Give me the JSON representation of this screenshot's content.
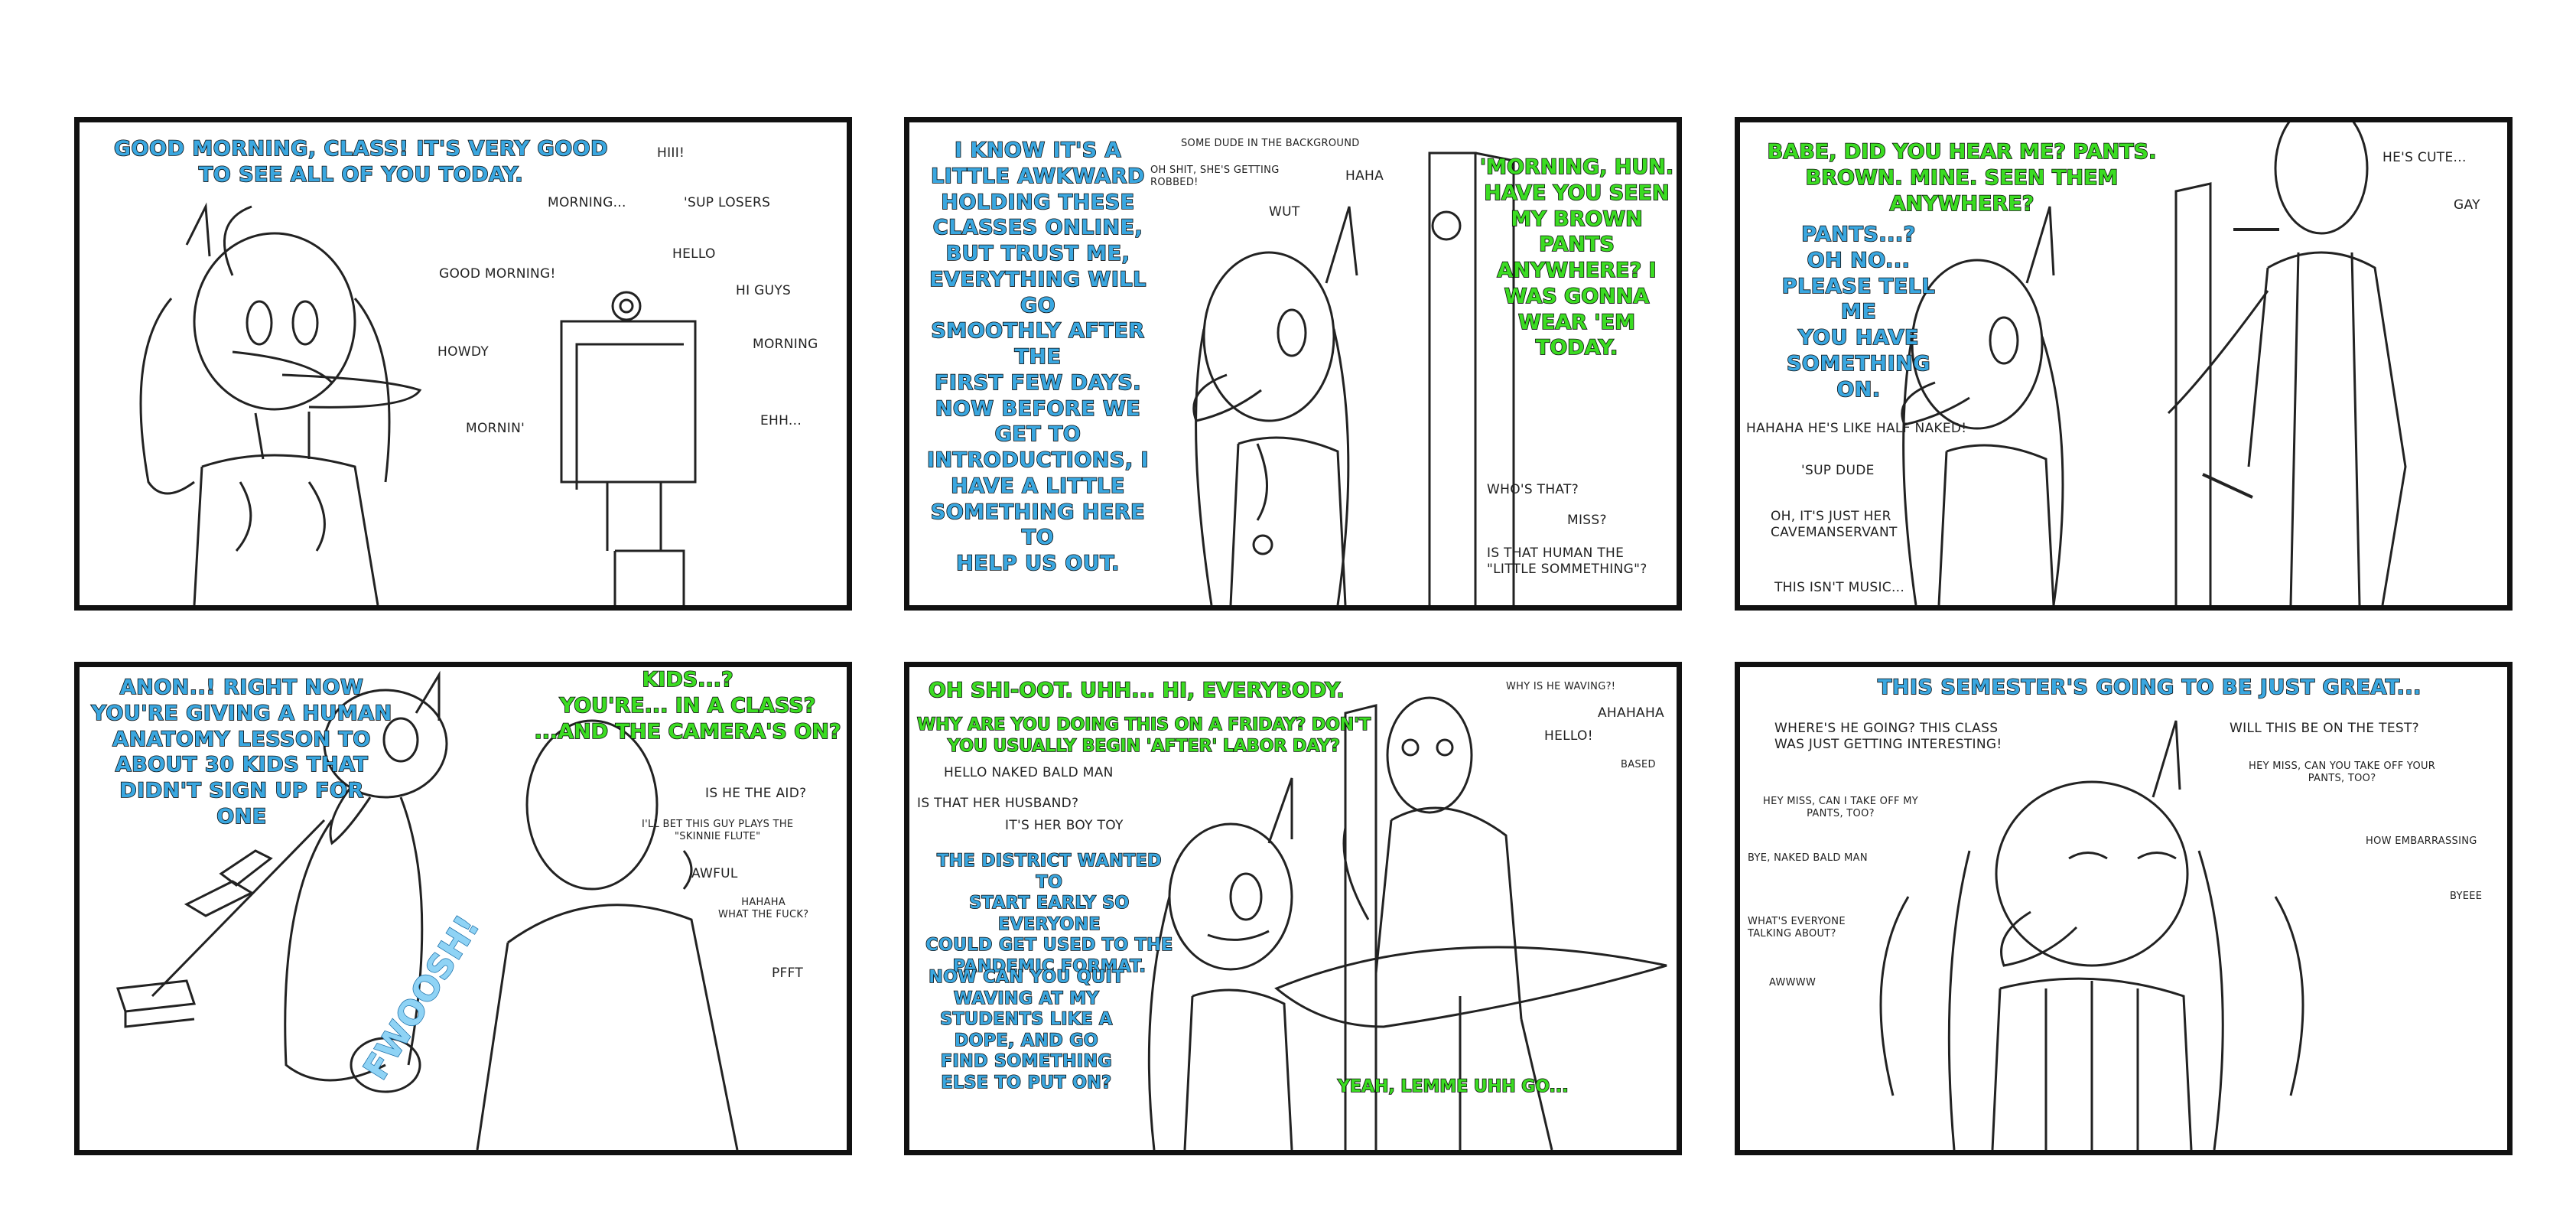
{
  "panels": {
    "p1": {
      "speech": "Good morning, class! It's very good\nto see all of you today.",
      "chat": [
        "Hiii!",
        "Morning...",
        "'Sup losers",
        "Hello",
        "Good morning!",
        "Hi guys",
        "Howdy",
        "Morning",
        "Mornin'",
        "Ehh..."
      ]
    },
    "p2": {
      "speech_teacher": "I know it's a\nlittle awkward\nholding these\nclasses online,\nbut trust me,\neverything will go\nsmoothly after the\nfirst few days.\nNow before we\nget to\nintroductions, I\nhave a little\nsomething here to\nhelp us out.",
      "speech_offscreen": "'Morning, hun.\nHave you seen\nmy brown\npants\nanywhere? I\nwas gonna\nwear 'em today.",
      "chat": [
        "Some dude in the background",
        "Oh shit, she's getting\nrobbed!",
        "Haha",
        "Wut",
        "Who's that?",
        "Miss?",
        "Is that human the\n\"little sommething\"?"
      ]
    },
    "p3": {
      "speech_offscreen": "Babe, did you hear me? Pants.\nBrown. Mine. Seen them anywhere?",
      "speech_teacher": "Pants...?\nOh no...\nPlease tell me\nyou have\nsomething on.",
      "chat": [
        "He's cute...",
        "Gay",
        "Hahaha he's like half naked!",
        "'Sup dude",
        "Oh, it's just her\ncavemanservant",
        "This isn't music..."
      ]
    },
    "p4": {
      "speech_teacher": "Anon..! Right now\nyou're giving a human\nanatomy lesson to\nabout 30 kids that\ndidn't sign up for\none",
      "speech_man": "Kids...?\nYou're... in a class?\n...and the camera's on?",
      "sfx": "FWOOSH!",
      "chat": [
        "Is he the aid?",
        "I'll bet this guy plays the\n\"skinnie flute\"",
        "Awful",
        "Hahaha\nwhat the fuck?",
        "Pfft"
      ]
    },
    "p5": {
      "speech_man": "Oh shi-oot. Uhh... hi, everybody.",
      "speech_man2": "Why are you doing this on a Friday? Don't\nyou usually begin 'after' labor day?",
      "speech_teacher": "The district wanted to\nstart early so everyone\ncould get used to the\npandemic format.",
      "speech_teacher2": "Now can you quit\nwaving at my\nstudents like a\ndope, and go\nfind something\nelse to put on?",
      "speech_reply": "Yeah, lemme uhh go...",
      "chat": [
        "Why is he waving?!",
        "Ahahaha",
        "Hello!",
        "Based",
        "Hello naked bald man",
        "Is that her husband?",
        "It's her boy toy"
      ]
    },
    "p6": {
      "speech_teacher": "This semester's going to be just great...",
      "chat": [
        "Where's he going? This class\nwas just getting interesting!",
        "Will this be on the test?",
        "Hey miss, can you take off your\npants, too?",
        "Hey miss, can I take off my\npants, too?",
        "How embarrassing",
        "Bye, naked bald man",
        "Byeee",
        "What's everyone\ntalking about?",
        "Awwww"
      ]
    }
  },
  "colors": {
    "teacher_text": "#3aa7e0",
    "other_text": "#3bdc22",
    "outline": "#111111"
  }
}
